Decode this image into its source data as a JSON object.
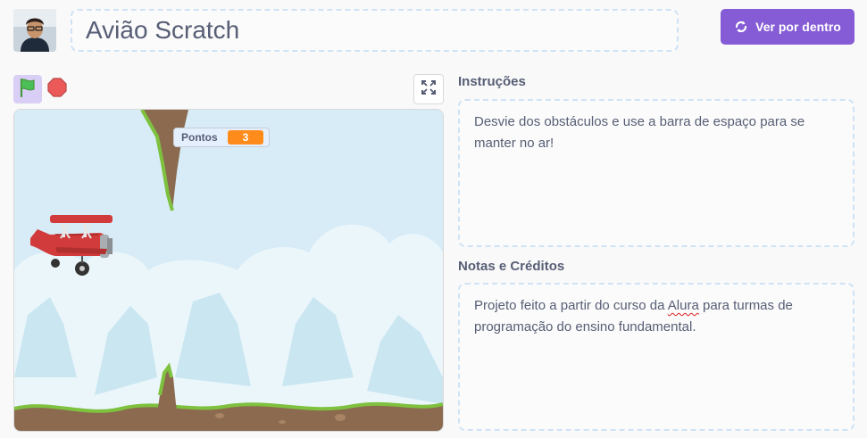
{
  "project": {
    "title": "Avião Scratch"
  },
  "header": {
    "see_inside_label": "Ver por dentro"
  },
  "stage": {
    "monitor_label": "Pontos",
    "monitor_value": "3"
  },
  "instructions": {
    "heading": "Instruções",
    "text": "Desvie dos obstáculos e use a barra de espaço para se manter no ar!"
  },
  "notes": {
    "heading": "Notas e Créditos",
    "text_before": "Projeto feito a partir do curso da ",
    "text_underlined": "Alura",
    "text_after": " para turmas de programação do ensino fundamental."
  },
  "colors": {
    "accent": "#855cd6",
    "flag_bg": "#d9cef5",
    "monitor_value_bg": "#ff8c1a",
    "box_border": "#cfe2f6"
  },
  "icons": [
    "avatar",
    "see-inside-icon",
    "green-flag-icon",
    "stop-icon",
    "fullscreen-icon"
  ]
}
